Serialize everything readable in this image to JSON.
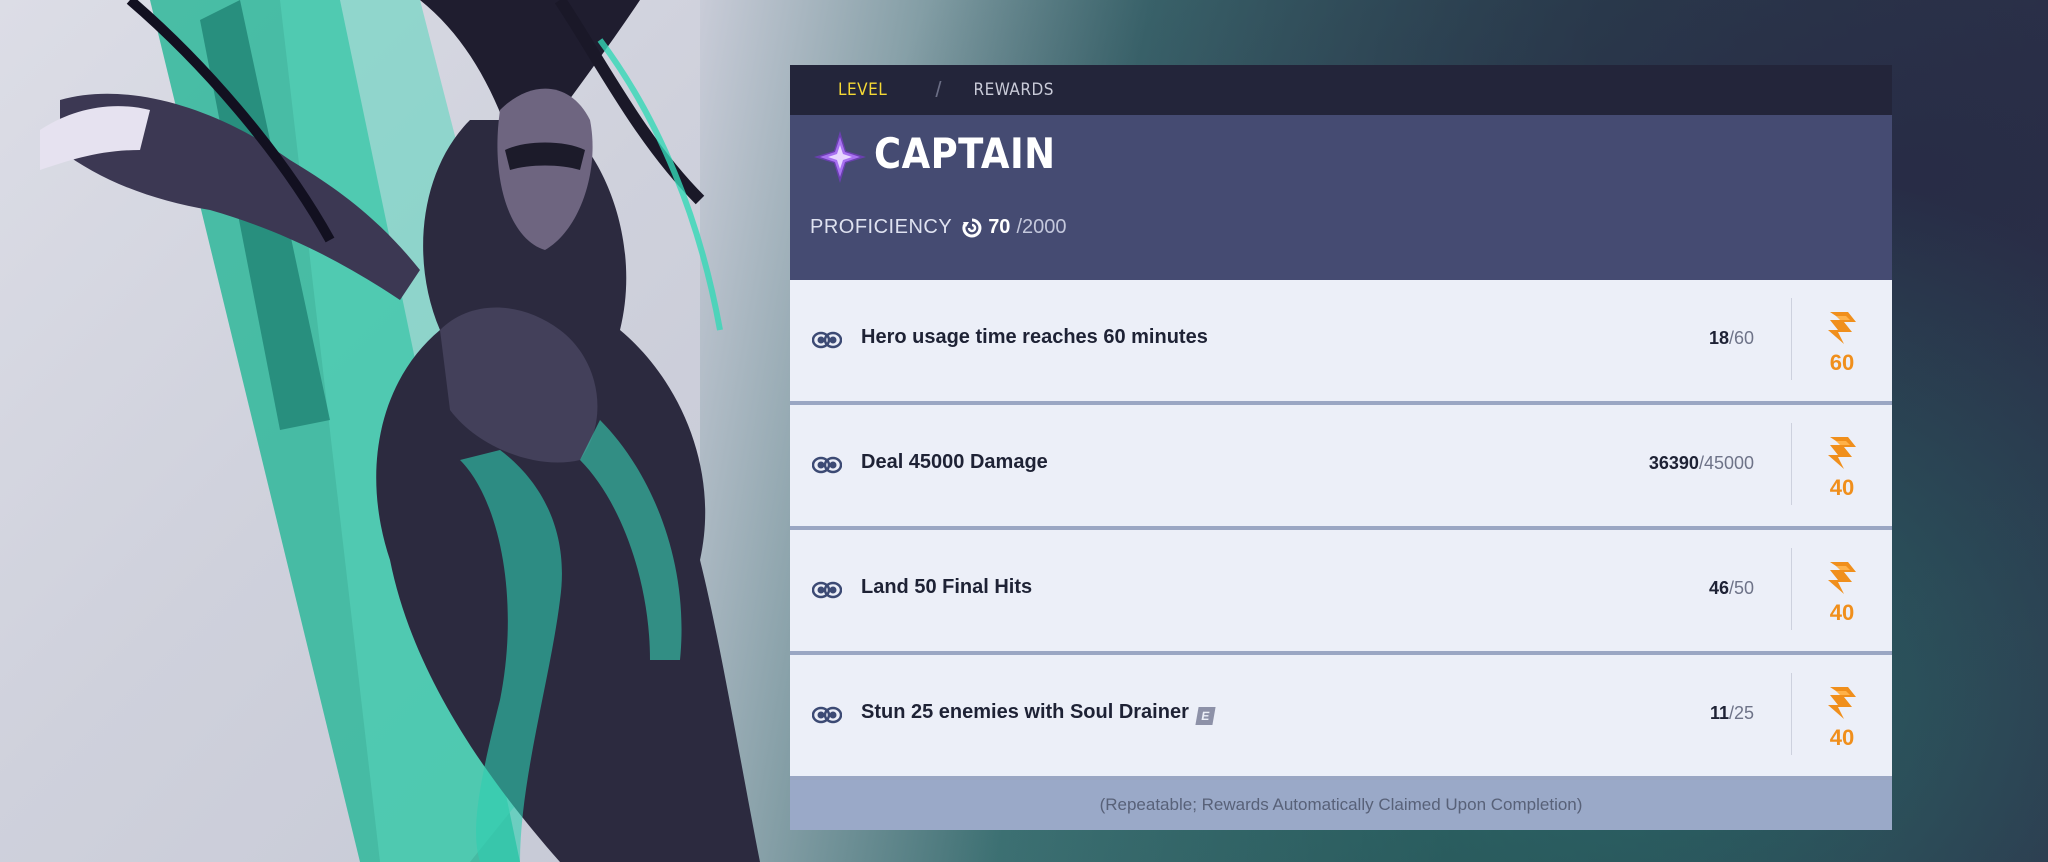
{
  "tabs": [
    {
      "label": "LEVEL",
      "active": true
    },
    {
      "label": "REWARDS",
      "active": false
    }
  ],
  "rank": {
    "title": "CAPTAIN",
    "icon": "purple-star-rank-icon"
  },
  "proficiency": {
    "label": "PROFICIENCY",
    "icon": "proficiency-swirl-icon",
    "current": "70",
    "max": "/2000",
    "progress_fraction": 0.035
  },
  "tasks": [
    {
      "text": "Hero usage time reaches 60 minutes",
      "current": "18",
      "max": "/60",
      "reward": "60",
      "badge": ""
    },
    {
      "text": "Deal 45000 Damage",
      "current": "36390",
      "max": "/45000",
      "reward": "40",
      "badge": ""
    },
    {
      "text": "Land 50 Final Hits",
      "current": "46",
      "max": "/50",
      "reward": "40",
      "badge": ""
    },
    {
      "text": "Stun 25 enemies with Soul Drainer",
      "current": "11",
      "max": "/25",
      "reward": "40",
      "badge": "E"
    }
  ],
  "footer_note": "(Repeatable; Rewards Automatically Claimed Upon Completion)",
  "colors": {
    "accent_yellow": "#f5d935",
    "reward_orange": "#f08f1c",
    "header_bg": "#454b72",
    "progress_fill": "#f3b52b"
  }
}
